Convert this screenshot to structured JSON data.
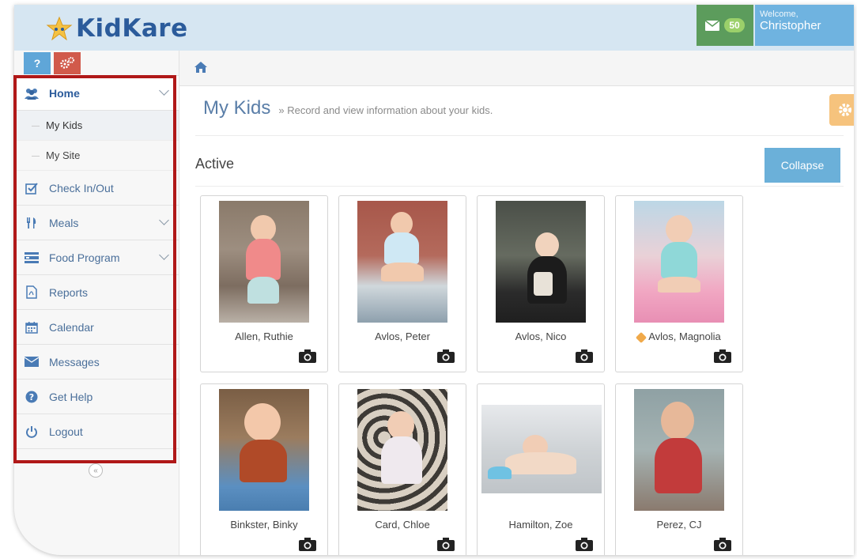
{
  "app": {
    "name": "KidKare"
  },
  "header": {
    "message_count": "50",
    "welcome_label": "Welcome,",
    "user_name": "Christopher"
  },
  "sidebar": {
    "items": [
      {
        "label": "Home",
        "icon": "users-icon",
        "expanded": true
      },
      {
        "label": "Check In/Out",
        "icon": "checkbox-icon"
      },
      {
        "label": "Meals",
        "icon": "utensils-icon"
      },
      {
        "label": "Food Program",
        "icon": "food-program-icon"
      },
      {
        "label": "Reports",
        "icon": "pdf-icon"
      },
      {
        "label": "Calendar",
        "icon": "calendar-icon"
      },
      {
        "label": "Messages",
        "icon": "envelope-icon"
      },
      {
        "label": "Get Help",
        "icon": "question-circle-icon"
      },
      {
        "label": "Logout",
        "icon": "power-icon"
      }
    ],
    "home_submenu": [
      {
        "label": "My Kids",
        "current": true
      },
      {
        "label": "My Site",
        "current": false
      }
    ]
  },
  "page": {
    "title": "My Kids",
    "subtitle": "» Record and view information about your kids.",
    "section_title": "Active",
    "collapse_label": "Collapse"
  },
  "kids": [
    {
      "name": "Allen, Ruthie"
    },
    {
      "name": "Avlos, Peter"
    },
    {
      "name": "Avlos, Nico"
    },
    {
      "name": "Avlos, Magnolia",
      "tagged": true
    },
    {
      "name": "Binkster, Binky"
    },
    {
      "name": "Card, Chloe"
    },
    {
      "name": "Hamilton, Zoe"
    },
    {
      "name": "Perez, CJ"
    }
  ],
  "colors": {
    "brand_blue": "#2b5b9b",
    "message_green": "#5c9c5c",
    "highlight_red": "#b01818",
    "collapse_blue": "#6bb0d9",
    "settings_orange": "#f6c37d"
  }
}
